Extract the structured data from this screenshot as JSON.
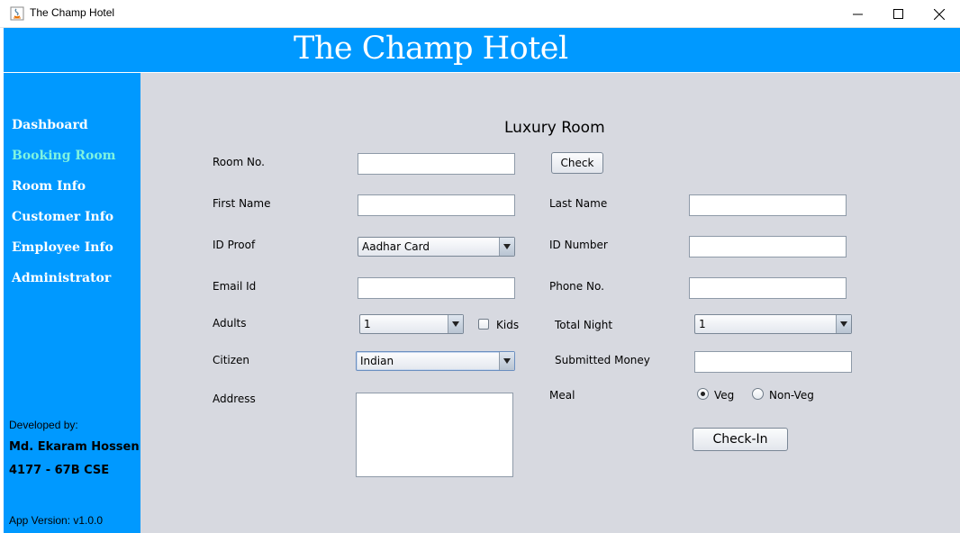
{
  "window": {
    "title": "The Champ Hotel",
    "controls": [
      "minimize-icon",
      "maximize-icon",
      "close-icon"
    ]
  },
  "header": {
    "title": "The Champ Hotel"
  },
  "sidebar": {
    "items": [
      {
        "label": "Dashboard",
        "active": false
      },
      {
        "label": "Booking Room",
        "active": true
      },
      {
        "label": "Room Info",
        "active": false
      },
      {
        "label": "Customer Info",
        "active": false
      },
      {
        "label": "Employee Info",
        "active": false
      },
      {
        "label": "Administrator",
        "active": false
      }
    ],
    "developed_by_label": "Developed by:",
    "developer_name": "Md. Ekaram Hossen",
    "developer_id": "4177 - 67B CSE",
    "app_version": "App Version: v1.0.0"
  },
  "form": {
    "heading": "Luxury Room",
    "room_no": {
      "label": "Room No.",
      "value": ""
    },
    "check_button": "Check",
    "first_name": {
      "label": "First Name",
      "value": ""
    },
    "last_name": {
      "label": "Last Name",
      "value": ""
    },
    "id_proof": {
      "label": "ID Proof",
      "selected": "Aadhar Card"
    },
    "id_number": {
      "label": "ID Number",
      "value": ""
    },
    "email": {
      "label": "Email Id",
      "value": ""
    },
    "phone": {
      "label": "Phone No.",
      "value": ""
    },
    "adults": {
      "label": "Adults",
      "selected": "1"
    },
    "kids": {
      "label": "Kids",
      "checked": false
    },
    "total_night": {
      "label": "Total Night",
      "selected": "1"
    },
    "citizen": {
      "label": "Citizen",
      "selected": "Indian"
    },
    "submitted_money": {
      "label": "Submitted Money",
      "value": ""
    },
    "address": {
      "label": "Address",
      "value": ""
    },
    "meal": {
      "label": "Meal",
      "options": [
        {
          "label": "Veg",
          "checked": true
        },
        {
          "label": "Non-Veg",
          "checked": false
        }
      ]
    },
    "checkin_button": "Check-In"
  },
  "colors": {
    "accent": "#0099ff",
    "active_nav": "#7ff3e0",
    "main_bg": "#d7d9e0"
  }
}
